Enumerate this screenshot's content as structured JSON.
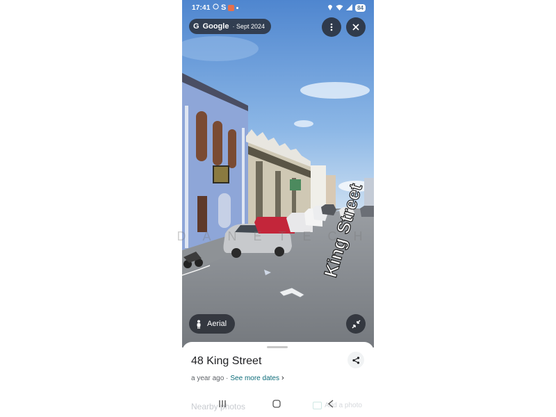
{
  "status_bar": {
    "time": "17:41",
    "app_glyph": "S",
    "battery": "84",
    "icons": [
      "whatsapp-icon",
      "location-icon",
      "wifi-icon",
      "signal-icon"
    ]
  },
  "source_chip": {
    "logo": "G",
    "brand": "Google",
    "date": "· Sept 2024"
  },
  "street_view": {
    "street_label": "King Street",
    "aerial_label": "Aerial"
  },
  "sheet": {
    "title": "48 King Street",
    "age": "a year ago ·",
    "more_dates": "See more dates",
    "nearby": "Nearby photos",
    "add_photo": "Add a photo"
  },
  "watermark": "DANETECH",
  "colors": {
    "chip_bg": "#282c34",
    "link": "#0b6b78",
    "sky": "#7aa9df"
  }
}
